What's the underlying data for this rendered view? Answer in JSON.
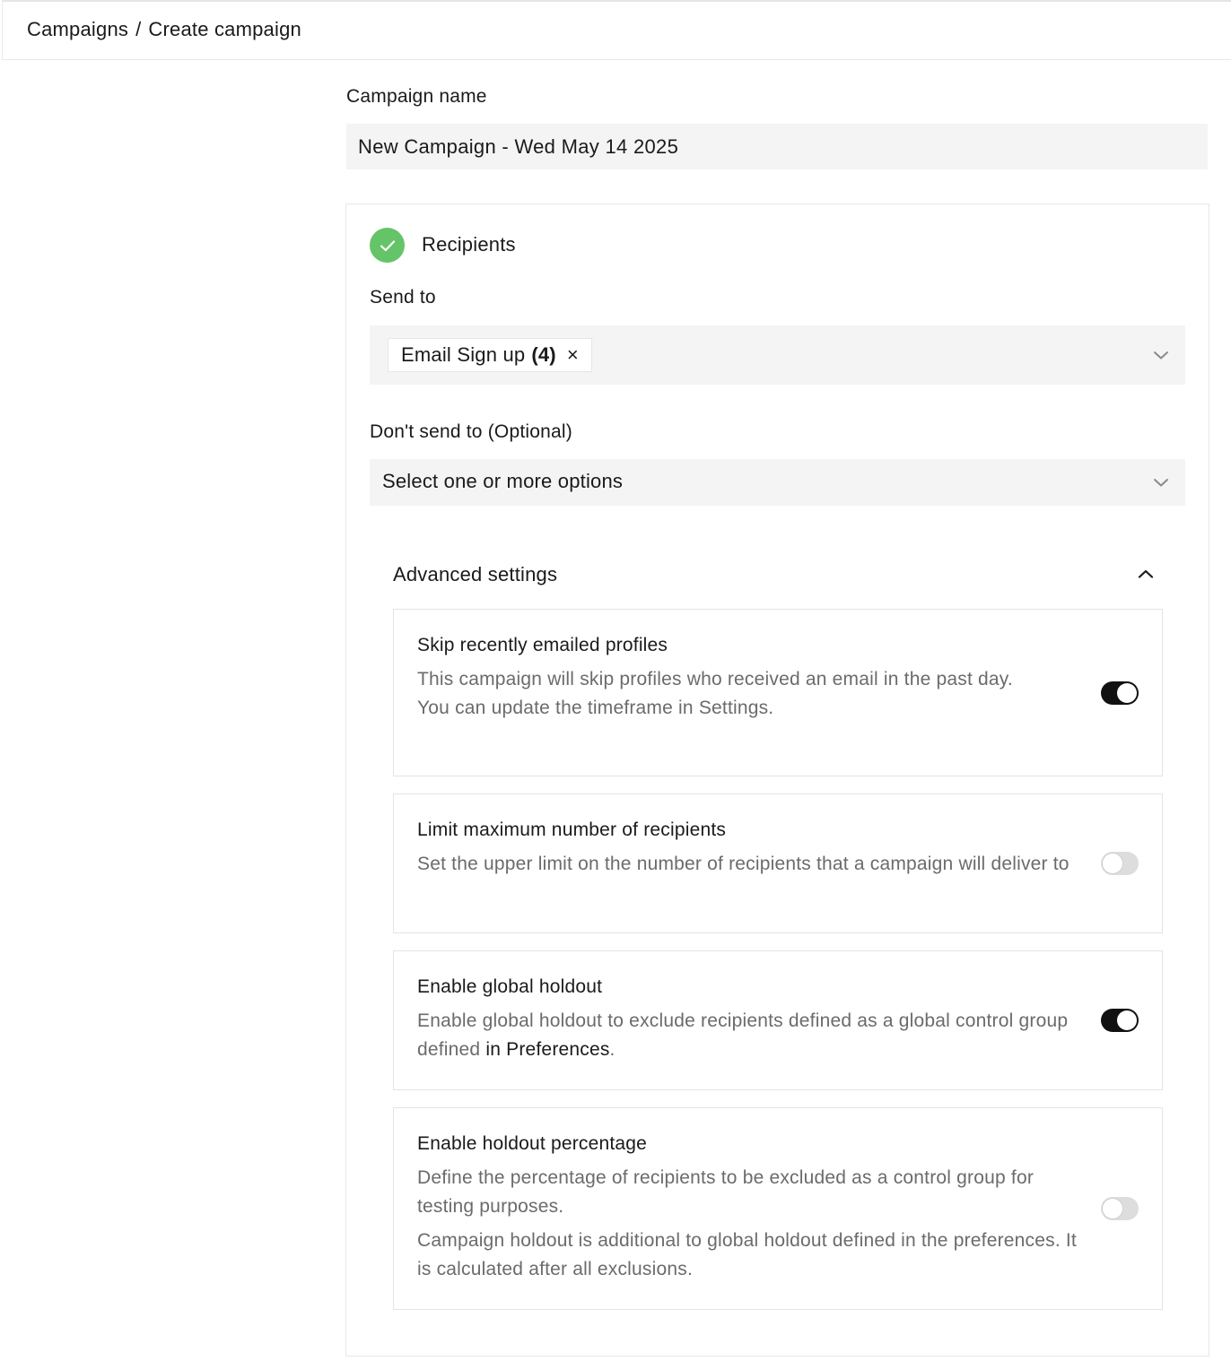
{
  "breadcrumb": {
    "parent": "Campaigns",
    "separator": "/",
    "current": "Create campaign"
  },
  "campaign_name": {
    "label": "Campaign name",
    "value": "New Campaign - Wed May 14 2025"
  },
  "recipients": {
    "title": "Recipients",
    "status_icon": "check-circle-icon",
    "status_color": "#66c468",
    "send_to": {
      "label": "Send to",
      "chip_label": "Email Sign up",
      "chip_count": "(4)",
      "chip_remove": "×"
    },
    "dont_send_to": {
      "label": "Don't send to (Optional)",
      "placeholder": "Select one or more options"
    }
  },
  "advanced": {
    "title": "Advanced settings",
    "expanded": true,
    "settings": [
      {
        "title": "Skip recently emailed profiles",
        "desc_1": "This campaign will skip profiles who received an email in the past day.",
        "desc_2": "You can update the timeframe in Settings.",
        "enabled": true
      },
      {
        "title": "Limit maximum number of recipients",
        "desc_1": "Set the upper limit on the number of recipients that a campaign will deliver to",
        "enabled": false
      },
      {
        "title": "Enable global holdout",
        "desc_1": "Enable global holdout to exclude recipients defined as a global control group defined",
        "desc_link": "in Preferences",
        "desc_end": ".",
        "enabled": true
      },
      {
        "title": "Enable holdout percentage",
        "desc_1": "Define the percentage of recipients to be excluded as a control group for testing purposes.",
        "desc_2": "Campaign holdout is additional to global holdout defined in the preferences. It is calculated after all exclusions.",
        "enabled": false
      }
    ]
  }
}
